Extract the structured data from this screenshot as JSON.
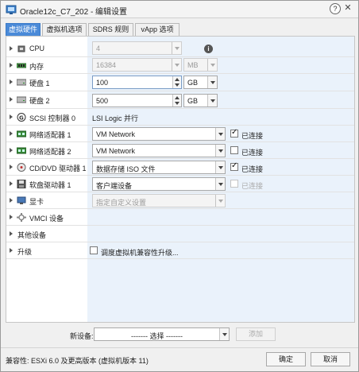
{
  "window": {
    "title": "Oracle12c_C7_202 - 编辑设置",
    "help_label": "?",
    "close_label": "✕"
  },
  "tabs": [
    {
      "label": "虚拟硬件",
      "active": true
    },
    {
      "label": "虚拟机选项",
      "active": false
    },
    {
      "label": "SDRS 规则",
      "active": false
    },
    {
      "label": "vApp 选项",
      "active": false
    }
  ],
  "rows": {
    "cpu": {
      "label": "CPU",
      "value": "4"
    },
    "memory": {
      "label": "内存",
      "value": "16384",
      "unit": "MB"
    },
    "disk1": {
      "label": "硬盘 1",
      "value": "100",
      "unit": "GB"
    },
    "disk2": {
      "label": "硬盘 2",
      "value": "500",
      "unit": "GB"
    },
    "scsi": {
      "label": "SCSI 控制器 0",
      "value": "LSI Logic 并行"
    },
    "nic1": {
      "label": "网络适配器 1",
      "value": "VM Network",
      "connected_label": "已连接",
      "connected": true
    },
    "nic2": {
      "label": "网络适配器 2",
      "value": "VM Network",
      "connected_label": "已连接",
      "connected": false
    },
    "cdrom": {
      "label": "CD/DVD 驱动器 1",
      "value": "数据存储 ISO 文件",
      "connected_label": "已连接",
      "connected": true
    },
    "floppy": {
      "label": "软盘驱动器 1",
      "value": "客户端设备",
      "connected_label": "已连接",
      "connected": false
    },
    "video": {
      "label": "显卡",
      "value": "指定自定义设置"
    },
    "vmci": {
      "label": "VMCI 设备"
    },
    "other": {
      "label": "其他设备"
    },
    "upgrade": {
      "label": "升级",
      "checkbox_label": "调度虚拟机兼容性升级..."
    }
  },
  "new_device": {
    "label": "新设备:",
    "select_value": "------- 选择 -------",
    "add_label": "添加"
  },
  "footer": {
    "compatibility": "兼容性: ESXi 6.0 及更高版本 (虚拟机版本 11)",
    "ok_label": "确定",
    "cancel_label": "取消"
  },
  "colors": {
    "tab_active": "#4a8ad8",
    "value_column": "#eaf2fb"
  },
  "icons": {
    "title": "vm-icon",
    "cpu": "cpu-chip-icon",
    "memory": "memory-icon",
    "disk": "hard-disk-icon",
    "scsi": "scsi-controller-icon",
    "nic": "network-adapter-icon",
    "cdrom": "cd-dvd-icon",
    "floppy": "floppy-drive-icon",
    "video": "video-card-icon",
    "vmci": "vmci-device-icon",
    "info": "info-icon"
  }
}
